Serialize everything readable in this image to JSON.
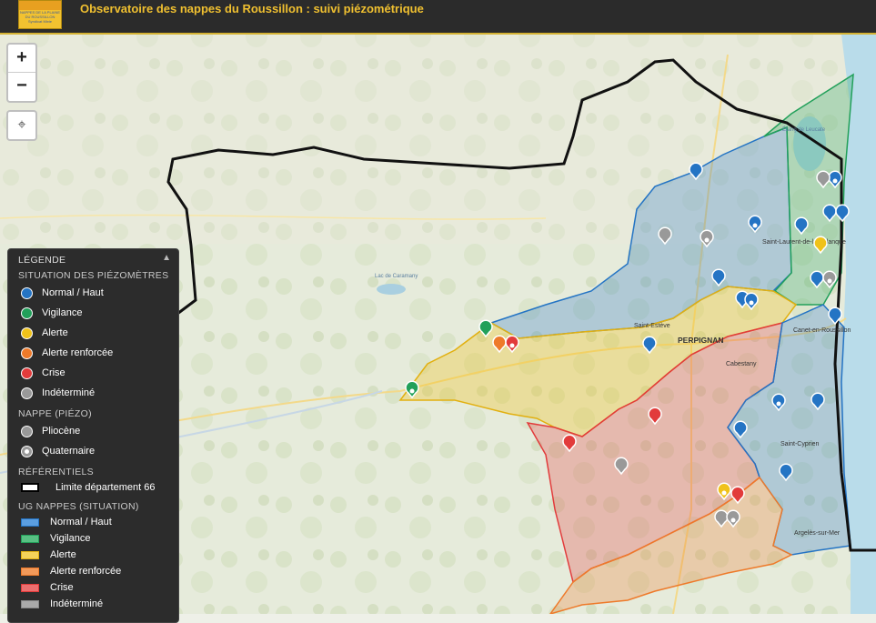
{
  "header": {
    "title": "Observatoire des nappes du Roussillon : suivi piézométrique",
    "logo_text": "NAPPES DE LA PLAINE DU ROUSSILLON Syndicat Mixte"
  },
  "controls": {
    "zoom_in": "+",
    "zoom_out": "−",
    "locate": "⌖"
  },
  "map_labels": {
    "lac": "Lac de Caramany",
    "etang": "Étang de Leucate",
    "st_laurent": "Saint-Laurent-de-la-Salanque",
    "st_esteve": "Saint-Estève",
    "perpignan": "PERPIGNAN",
    "cabestany": "Cabestany",
    "canet": "Canet-en-Roussillon",
    "st_cyprien": "Saint-Cyprien",
    "argeles": "Argelès-sur-Mer"
  },
  "legend": {
    "title": "LÉGENDE",
    "toggle": "▲",
    "sec1": "SITUATION DES PIÉZOMÈTRES",
    "s1": [
      "Normal / Haut",
      "Vigilance",
      "Alerte",
      "Alerte renforcée",
      "Crise",
      "Indéterminé"
    ],
    "sec2": "NAPPE (PIÉZO)",
    "s2": [
      "Pliocène",
      "Quaternaire"
    ],
    "sec3": "RÉFÉRENTIELS",
    "s3": [
      "Limite département 66"
    ],
    "sec4": "UG NAPPES (SITUATION)",
    "s4": [
      "Normal / Haut",
      "Vigilance",
      "Alerte",
      "Alerte renforcée",
      "Crise",
      "Indéterminé"
    ]
  },
  "colors": {
    "normal": "#2474c4",
    "vigilance": "#22a05a",
    "alerte": "#f0c21a",
    "alerte_renforcee": "#ee7a2a",
    "crise": "#e23b3b",
    "indetermine": "#999999"
  }
}
